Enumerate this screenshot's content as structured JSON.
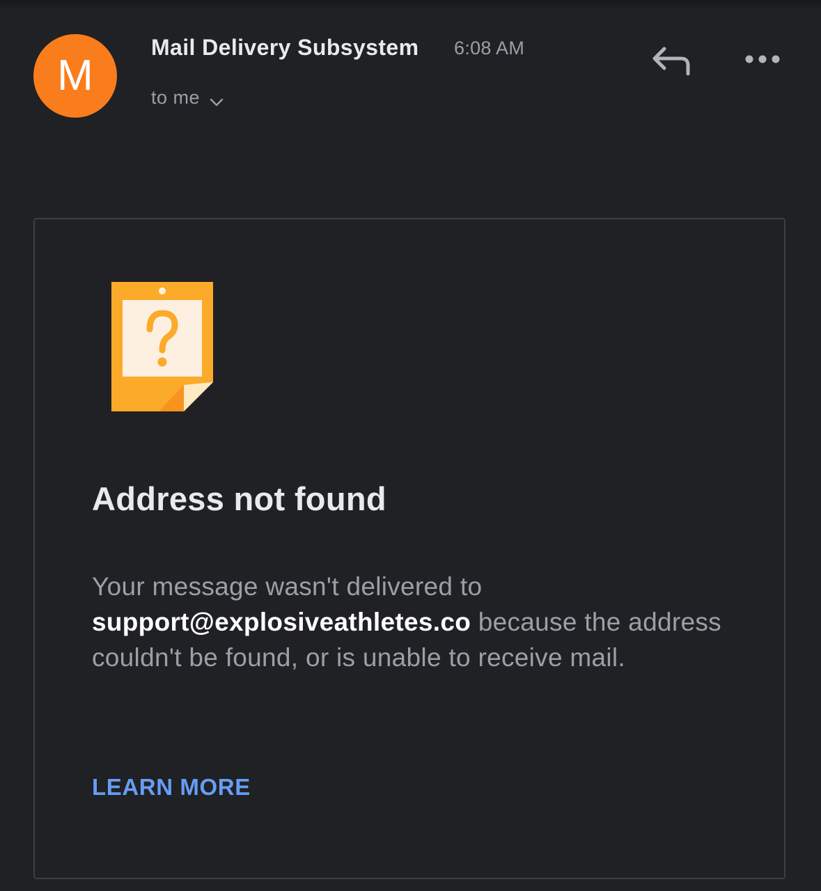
{
  "email": {
    "avatar_letter": "M",
    "sender": "Mail Delivery Subsystem",
    "time": "6:08 AM",
    "recipient_label": "to me",
    "actions": {
      "reply_icon": "reply-icon",
      "more_icon": "more-horizontal-icon",
      "expand_icon": "chevron-down-icon"
    }
  },
  "notice": {
    "icon": "note-question-icon",
    "title": "Address not found",
    "body_prefix": "Your message wasn't delivered to ",
    "address": "support@explosiveathletes.co",
    "body_suffix": " because the address couldn't be found, or is unable to receive mail.",
    "link_label": "LEARN MORE"
  },
  "colors": {
    "background": "#202124",
    "avatar": "#f97d1c",
    "link": "#669df6",
    "note_orange": "#fbaa2a",
    "note_fold": "#f7931e"
  }
}
